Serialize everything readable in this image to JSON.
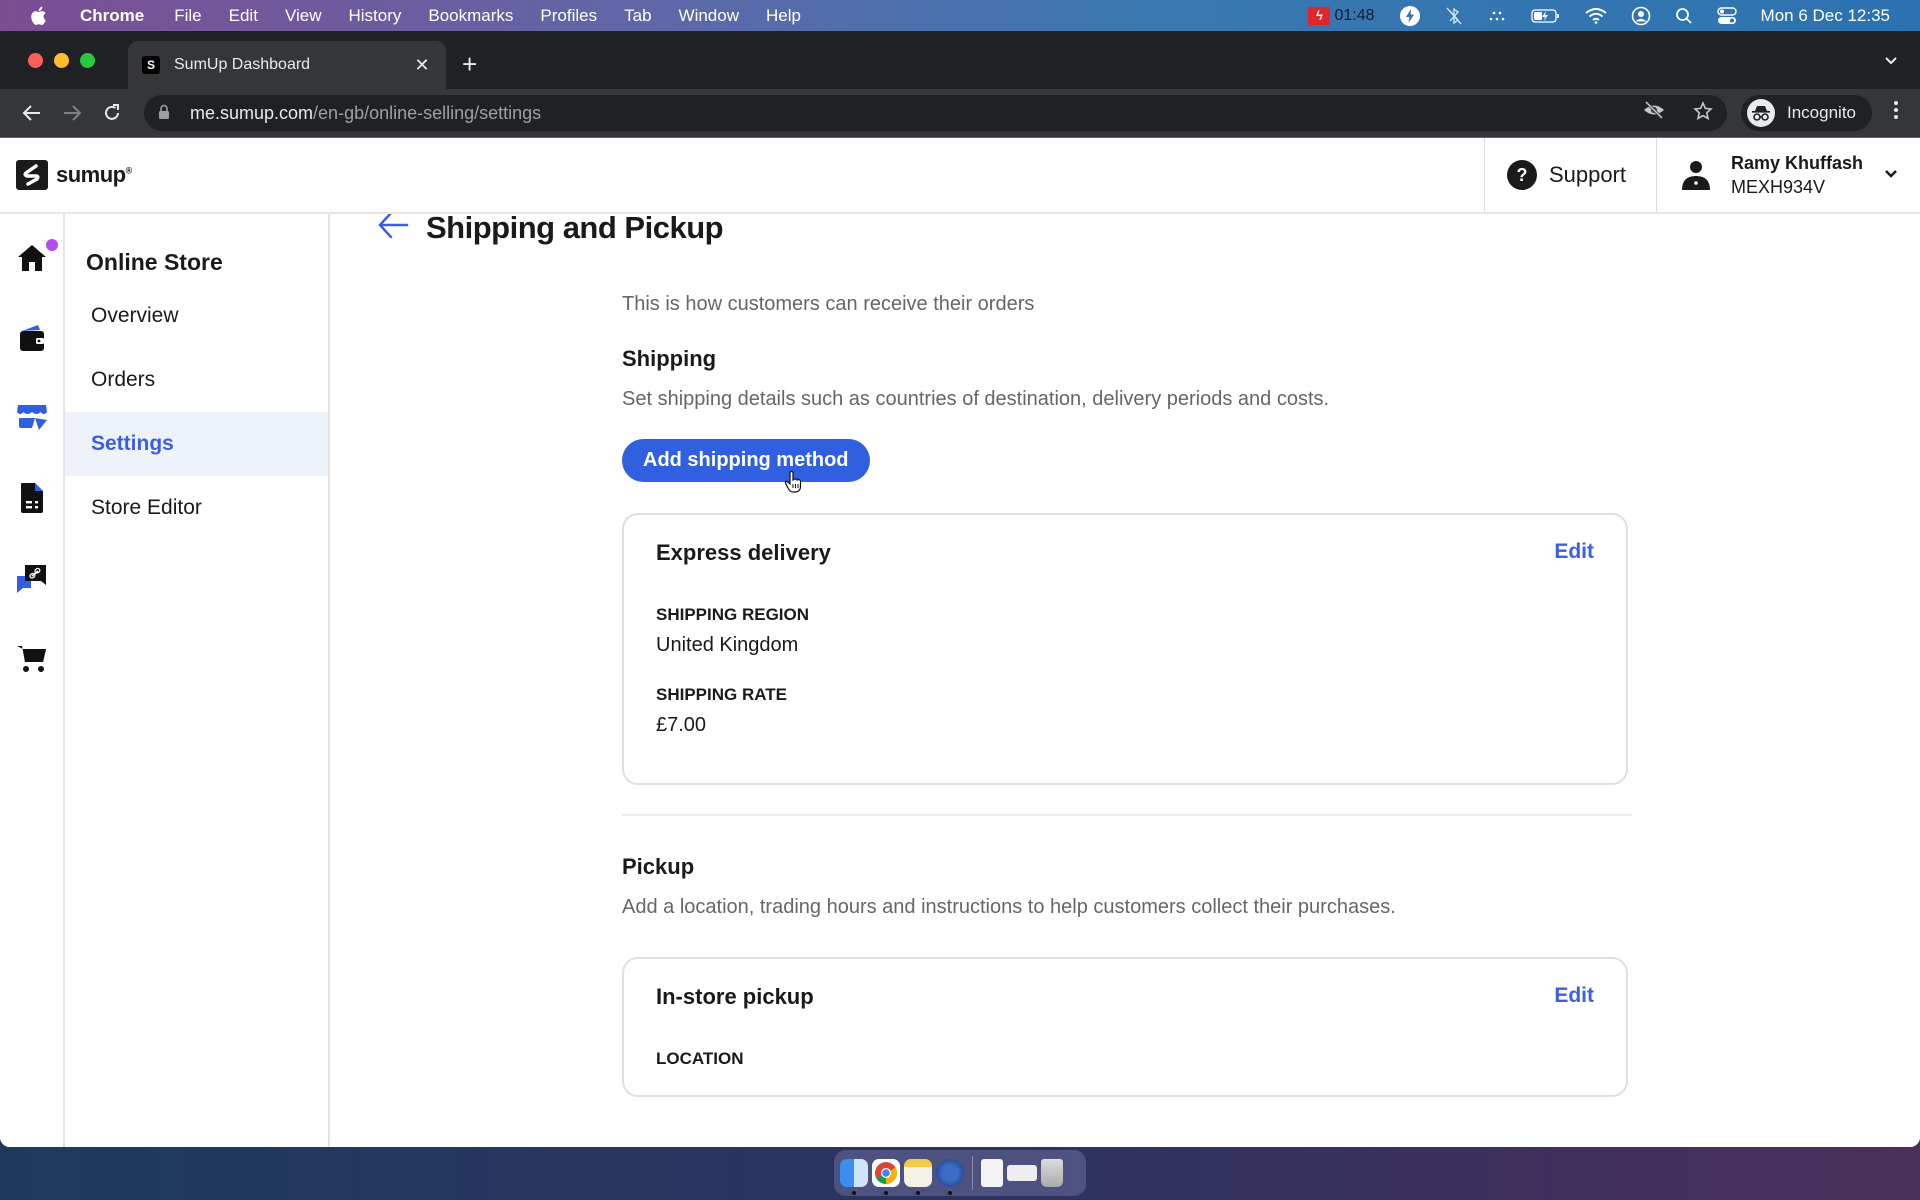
{
  "menubar": {
    "app_name": "Chrome",
    "items": [
      "File",
      "Edit",
      "View",
      "History",
      "Bookmarks",
      "Profiles",
      "Tab",
      "Window",
      "Help"
    ],
    "recording_time": "01:48",
    "clock": "Mon 6 Dec  12:35",
    "status_icons": [
      "recording-icon",
      "bolt-icon",
      "bluetooth-off-icon",
      "dots-icon",
      "battery-icon",
      "wifi-icon",
      "user-icon",
      "search-icon",
      "control-center-icon"
    ]
  },
  "browser": {
    "tab_title": "SumUp Dashboard",
    "tab_close": "✕",
    "new_tab": "+",
    "url_host": "me.sumup.com",
    "url_path": "/en-gb/online-selling/settings",
    "profile_label": "Incognito"
  },
  "header": {
    "brand_name": "sumup",
    "support_label": "Support",
    "account_name": "Ramy Khuffash",
    "account_id": "MEXH934V"
  },
  "rail": {
    "items": [
      {
        "name": "home",
        "has_notification": true,
        "active": false
      },
      {
        "name": "wallet",
        "active": false
      },
      {
        "name": "online-store",
        "active": true
      },
      {
        "name": "invoices",
        "active": false
      },
      {
        "name": "payment-links",
        "active": false
      },
      {
        "name": "shop",
        "active": false
      }
    ],
    "notification_color": "#b44cf0"
  },
  "subnav": {
    "title": "Online Store",
    "items": [
      {
        "label": "Overview",
        "active": false
      },
      {
        "label": "Orders",
        "active": false
      },
      {
        "label": "Settings",
        "active": true
      },
      {
        "label": "Store Editor",
        "active": false
      }
    ]
  },
  "page": {
    "title": "Shipping and Pickup",
    "intro": "This is how customers can receive their orders",
    "shipping": {
      "title": "Shipping",
      "description": "Set shipping details such as countries of destination, delivery periods and costs.",
      "add_button": "Add shipping method",
      "methods": [
        {
          "name": "Express delivery",
          "edit_label": "Edit",
          "region_label": "Shipping region",
          "region_value": "United Kingdom",
          "rate_label": "Shipping rate",
          "rate_value": "£7.00"
        }
      ]
    },
    "pickup": {
      "title": "Pickup",
      "description": "Add a location, trading hours and instructions to help customers collect their purchases.",
      "methods": [
        {
          "name": "In-store pickup",
          "edit_label": "Edit",
          "location_label": "Location"
        }
      ]
    }
  },
  "colors": {
    "accent": "#3060e0",
    "link": "#3e5ee0",
    "active_bg": "#eef3fb"
  },
  "dock": {
    "apps": [
      "Finder",
      "Chrome",
      "Notes",
      "Reeder",
      "Preview",
      "Screenshot",
      "Trash"
    ]
  }
}
